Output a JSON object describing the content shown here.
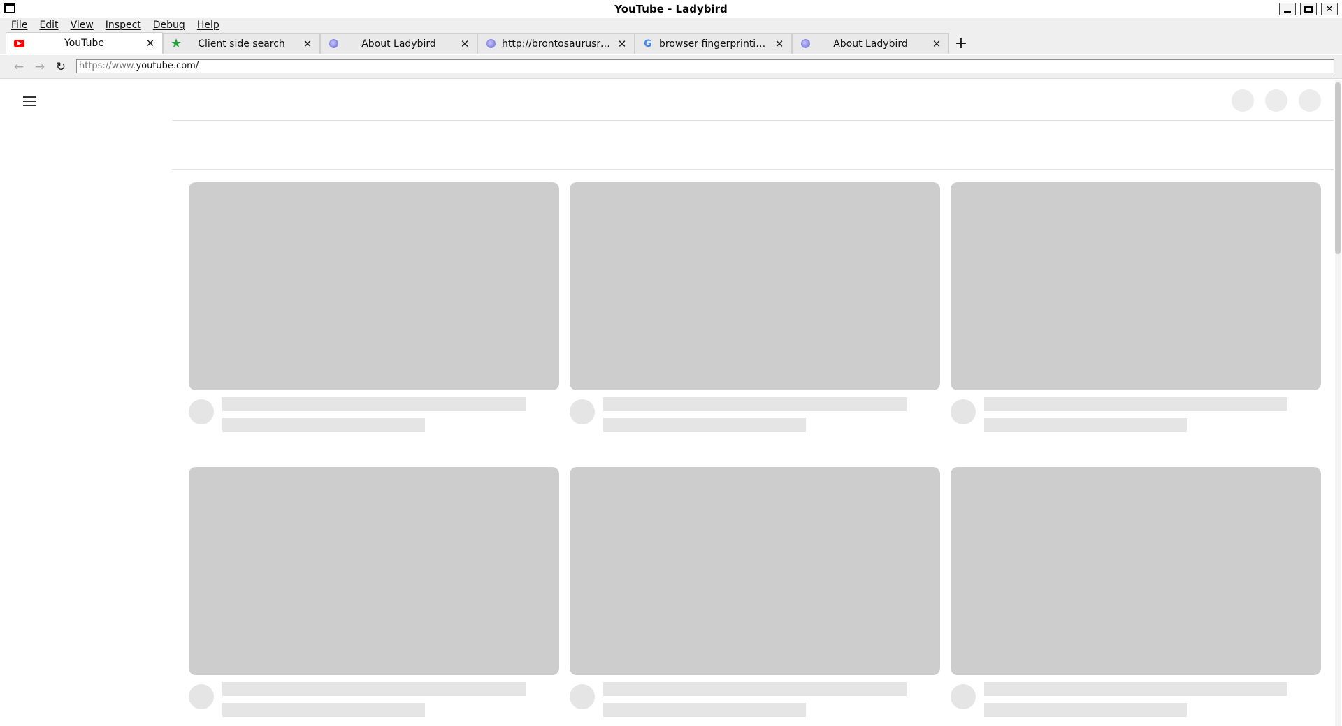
{
  "window": {
    "title": "YouTube - Ladybird"
  },
  "menu": [
    "File",
    "Edit",
    "View",
    "Inspect",
    "Debug",
    "Help"
  ],
  "tabs": [
    {
      "label": "YouTube",
      "icon": "youtube-icon",
      "active": true
    },
    {
      "label": "Client side search",
      "icon": "star-icon",
      "active": false
    },
    {
      "label": "About Ladybird",
      "icon": "ladybird-icon",
      "active": false
    },
    {
      "label": "http://brontosaurusrex....",
      "icon": "ladybird-icon",
      "active": false
    },
    {
      "label": "browser fingerprinting t...",
      "icon": "google-icon",
      "active": false
    },
    {
      "label": "About Ladybird",
      "icon": "ladybird-icon",
      "active": false
    }
  ],
  "toolbar": {
    "url_scheme": "https://www.",
    "url_host": "youtube.com/"
  },
  "glyphs": {
    "close": "✕",
    "new_tab": "+",
    "back": "←",
    "forward": "→",
    "reload": "↻",
    "window_close": "✕"
  }
}
